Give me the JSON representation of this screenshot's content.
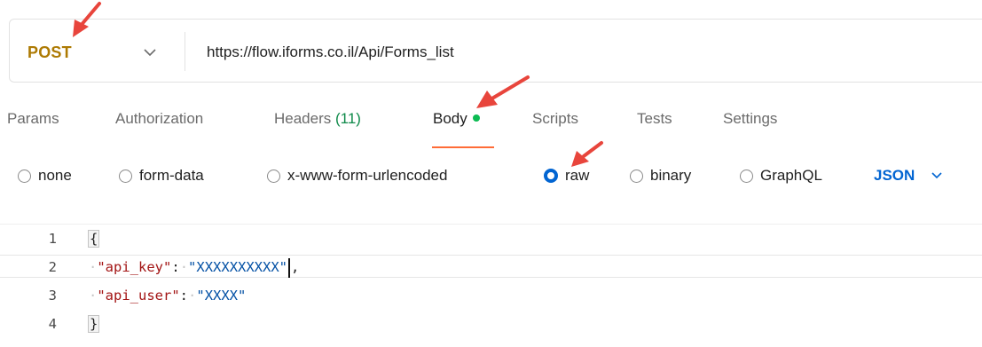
{
  "request": {
    "method": "POST",
    "url": "https://flow.iforms.co.il/Api/Forms_list"
  },
  "tabs": [
    {
      "label": "Params"
    },
    {
      "label": "Authorization"
    },
    {
      "label": "Headers",
      "count": "(11)"
    },
    {
      "label": "Body",
      "active": true
    },
    {
      "label": "Scripts"
    },
    {
      "label": "Tests"
    },
    {
      "label": "Settings"
    }
  ],
  "body_types": {
    "options": [
      "none",
      "form-data",
      "x-www-form-urlencoded",
      "raw",
      "binary",
      "GraphQL"
    ],
    "selected": "raw",
    "language": "JSON"
  },
  "editor": {
    "line_numbers": [
      "1",
      "2",
      "3",
      "4"
    ],
    "open_brace": "{",
    "close_brace": "}",
    "key1": "\"api_key\"",
    "val1": "\"XXXXXXXXXX\"",
    "key2": "\"api_user\"",
    "val2": "\"XXXX\"",
    "colon": ":",
    "comma": ",",
    "space_dot": "·"
  },
  "colors": {
    "method": "#ad7a03",
    "accent": "#0265d2",
    "tab_underline": "#ff6c37",
    "active_dot": "#0cbb52",
    "annotation_arrow": "#e8453c"
  }
}
